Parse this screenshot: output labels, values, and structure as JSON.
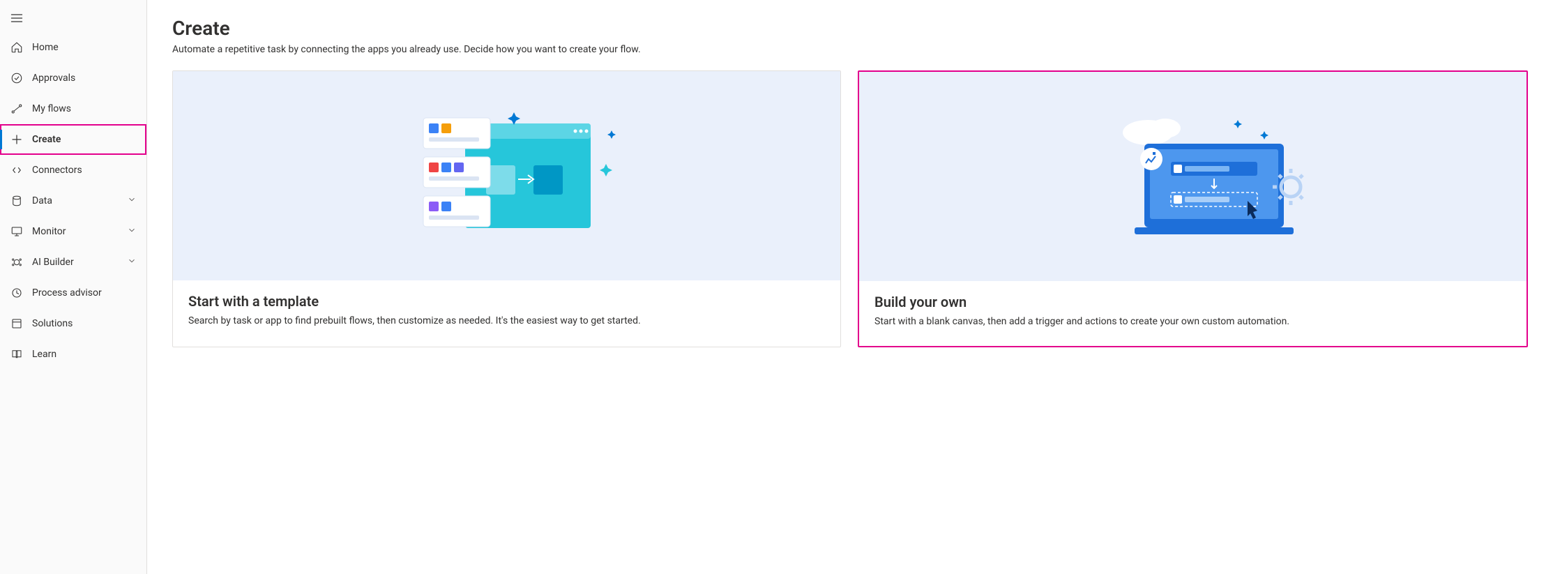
{
  "sidebar": {
    "items": [
      {
        "id": "home",
        "label": "Home"
      },
      {
        "id": "approvals",
        "label": "Approvals"
      },
      {
        "id": "myflows",
        "label": "My flows"
      },
      {
        "id": "create",
        "label": "Create"
      },
      {
        "id": "connectors",
        "label": "Connectors"
      },
      {
        "id": "data",
        "label": "Data"
      },
      {
        "id": "monitor",
        "label": "Monitor"
      },
      {
        "id": "aibuilder",
        "label": "AI Builder"
      },
      {
        "id": "processadvisor",
        "label": "Process advisor"
      },
      {
        "id": "solutions",
        "label": "Solutions"
      },
      {
        "id": "learn",
        "label": "Learn"
      }
    ]
  },
  "page": {
    "title": "Create",
    "subtitle": "Automate a repetitive task by connecting the apps you already use. Decide how you want to create your flow."
  },
  "cards": {
    "template": {
      "title": "Start with a template",
      "desc": "Search by task or app to find prebuilt flows, then customize as needed. It's the easiest way to get started."
    },
    "build": {
      "title": "Build your own",
      "desc": "Start with a blank canvas, then add a trigger and actions to create your own custom automation."
    }
  },
  "colors": {
    "accent": "#0078d4",
    "highlight": "#e3008c"
  }
}
